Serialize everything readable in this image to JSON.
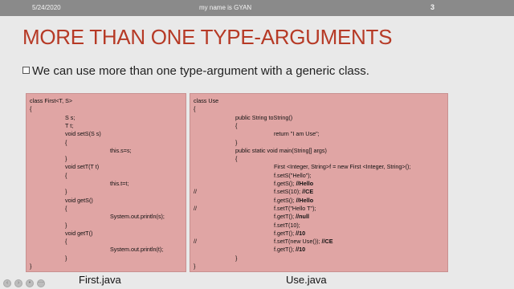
{
  "header": {
    "date": "5/24/2020",
    "author": "my name is GYAN",
    "page_number": "3"
  },
  "title": "MORE THAN ONE TYPE-ARGUMENTS",
  "bullet": "We can use more than one type-argument with a generic class.",
  "first_code": [
    {
      "text": "class First<T, S>"
    },
    {
      "text": "{"
    },
    {
      "text": "S s;"
    },
    {
      "text": "T t;"
    },
    {
      "text": "void setS(S s)"
    },
    {
      "text": "{"
    },
    {
      "text": "this.s=s;"
    },
    {
      "text": "}"
    },
    {
      "text": "void setT(T t)"
    },
    {
      "text": "{"
    },
    {
      "text": "this.t=t;"
    },
    {
      "text": "}"
    },
    {
      "text": "void getS()"
    },
    {
      "text": "{"
    },
    {
      "text": "System.out.println(s);"
    },
    {
      "text": "}"
    },
    {
      "text": "void getT()"
    },
    {
      "text": "{"
    },
    {
      "text": "System.out.println(t);"
    },
    {
      "text": "}"
    },
    {
      "text": "}"
    }
  ],
  "use_code": [
    {
      "text": "class Use"
    },
    {
      "text": "{"
    },
    {
      "text": "public String toString()"
    },
    {
      "text": "{"
    },
    {
      "text": "return \"I am Use\";"
    },
    {
      "text": "}"
    },
    {
      "text": "public static void main(String[] args)"
    },
    {
      "text": "{"
    },
    {
      "text": "First <Integer, String>f = new First <Integer, String>();"
    },
    {
      "text": "f.setS(\"Hello\");"
    },
    {
      "text": "f.getS(); ",
      "bold": "//Hello"
    },
    {
      "comment": "//",
      "text": "f.setS(10); ",
      "bold": "//CE"
    },
    {
      "text": "f.getS(); ",
      "bold": "//Hello"
    },
    {
      "comment": "//",
      "text": "f.setT(\"Hello T\");"
    },
    {
      "text": "f.getT(); ",
      "bold": "//null"
    },
    {
      "text": "f.setT(10);"
    },
    {
      "text": "f.getT(); ",
      "bold": "//10"
    },
    {
      "comment": "//",
      "text": "f.setT(new Use()); ",
      "bold": "//CE"
    },
    {
      "text": "f.getT(); ",
      "bold": "//10"
    },
    {
      "text": "}"
    },
    {
      "text": "}"
    }
  ],
  "captions": {
    "first": "First.java",
    "use": "Use.java"
  }
}
